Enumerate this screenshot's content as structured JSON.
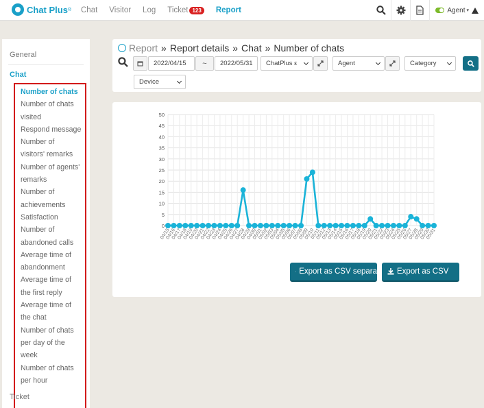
{
  "nav": {
    "logo": "Chat Plus",
    "logo_mark": "®",
    "items": [
      "Chat",
      "Visitor",
      "Log",
      "Ticket",
      "Report"
    ],
    "ticket_badge": "123",
    "agent_label": "Agent"
  },
  "sidebar": {
    "general": "General",
    "chat": "Chat",
    "items": [
      "Number of chats",
      "Number of chats",
      "visited",
      "Respond message",
      "Number of",
      "visitors' remarks",
      "Number of agents'",
      "remarks",
      "Number of",
      "achievements",
      "Satisfaction",
      "Number of",
      "abandoned calls",
      "Average time of",
      "abandonment",
      "Average time of",
      "the first reply",
      "Average time of",
      "the chat",
      "Number of chats",
      "per day of the",
      "week",
      "Number of chats",
      "per hour"
    ],
    "ticket": "Ticket"
  },
  "breadcrumb": {
    "report": "Report",
    "sep": "»",
    "details": "Report details",
    "chat": "Chat",
    "current": "Number of chats"
  },
  "filters": {
    "date_from": "2022/04/15",
    "range_sep": "~",
    "date_to": "2022/05/31",
    "site": "ChatPlus ε",
    "agent": "Agent",
    "category": "Category",
    "device": "Device"
  },
  "chart_data": {
    "type": "line",
    "ylim": [
      0,
      50
    ],
    "yticks": [
      0,
      5,
      10,
      15,
      20,
      25,
      30,
      35,
      40,
      45,
      50
    ],
    "x": [
      "04/15",
      "04/16",
      "04/17",
      "04/18",
      "04/19",
      "04/20",
      "04/21",
      "04/22",
      "04/23",
      "04/24",
      "04/25",
      "04/26",
      "04/27",
      "04/28",
      "04/29",
      "04/30",
      "05/01",
      "05/02",
      "05/03",
      "05/04",
      "05/05",
      "05/06",
      "05/07",
      "05/08",
      "05/09",
      "05/10",
      "05/11",
      "05/12",
      "05/13",
      "05/14",
      "05/15",
      "05/16",
      "05/17",
      "05/18",
      "05/19",
      "05/20",
      "05/21",
      "05/22",
      "05/23",
      "05/24",
      "05/25",
      "05/26",
      "05/27",
      "05/28",
      "05/29",
      "05/30",
      "05/31"
    ],
    "values": [
      0,
      0,
      0,
      0,
      0,
      0,
      0,
      0,
      0,
      0,
      0,
      0,
      0,
      16,
      0,
      0,
      0,
      0,
      0,
      0,
      0,
      0,
      0,
      0,
      21,
      24,
      0,
      0,
      0,
      0,
      0,
      0,
      0,
      0,
      0,
      3,
      0,
      0,
      0,
      0,
      0,
      0,
      4,
      3,
      0,
      0,
      0
    ],
    "color": "#1ab3d8",
    "grid": true
  },
  "export": {
    "separate": "Export as CSV separa",
    "csv": "Export as CSV"
  }
}
